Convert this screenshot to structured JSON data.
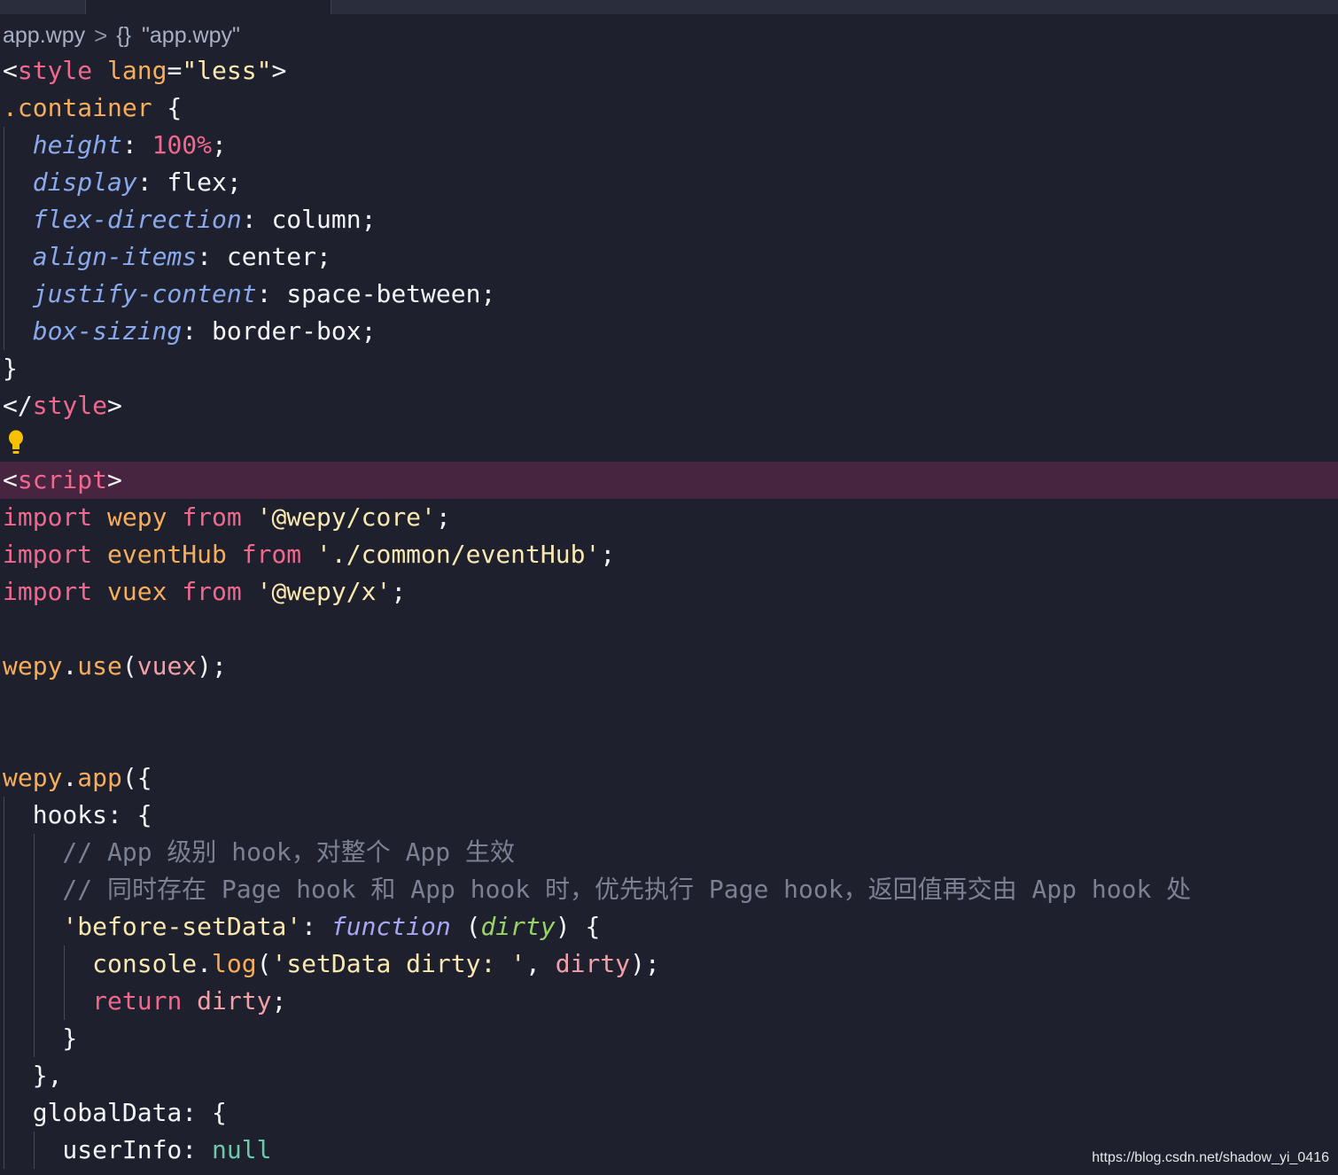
{
  "breadcrumb": {
    "file": "app.wpy",
    "separator": ">",
    "braces": "{}",
    "symbol": "\"app.wpy\""
  },
  "code": {
    "l1": [
      {
        "t": "<",
        "c": "punc"
      },
      {
        "t": "style",
        "c": "tag"
      },
      {
        "t": " ",
        "c": "punc"
      },
      {
        "t": "lang",
        "c": "attr"
      },
      {
        "t": "=",
        "c": "punc"
      },
      {
        "t": "\"less\"",
        "c": "str"
      },
      {
        "t": ">",
        "c": "punc"
      }
    ],
    "l2": [
      {
        "t": ".container",
        "c": "id"
      },
      {
        "t": " {",
        "c": "punc"
      }
    ],
    "l3": [
      {
        "t": "  ",
        "c": "punc"
      },
      {
        "t": "height",
        "c": "prop"
      },
      {
        "t": ": ",
        "c": "punc"
      },
      {
        "t": "100%",
        "c": "num"
      },
      {
        "t": ";",
        "c": "punc"
      }
    ],
    "l4": [
      {
        "t": "  ",
        "c": "punc"
      },
      {
        "t": "display",
        "c": "prop"
      },
      {
        "t": ": ",
        "c": "punc"
      },
      {
        "t": "flex",
        "c": "val"
      },
      {
        "t": ";",
        "c": "punc"
      }
    ],
    "l5": [
      {
        "t": "  ",
        "c": "punc"
      },
      {
        "t": "flex-direction",
        "c": "prop"
      },
      {
        "t": ": ",
        "c": "punc"
      },
      {
        "t": "column",
        "c": "val"
      },
      {
        "t": ";",
        "c": "punc"
      }
    ],
    "l6": [
      {
        "t": "  ",
        "c": "punc"
      },
      {
        "t": "align-items",
        "c": "prop"
      },
      {
        "t": ": ",
        "c": "punc"
      },
      {
        "t": "center",
        "c": "val"
      },
      {
        "t": ";",
        "c": "punc"
      }
    ],
    "l7": [
      {
        "t": "  ",
        "c": "punc"
      },
      {
        "t": "justify-content",
        "c": "prop"
      },
      {
        "t": ": ",
        "c": "punc"
      },
      {
        "t": "space-between",
        "c": "val"
      },
      {
        "t": ";",
        "c": "punc"
      }
    ],
    "l8": [
      {
        "t": "  ",
        "c": "punc"
      },
      {
        "t": "box-sizing",
        "c": "prop"
      },
      {
        "t": ": ",
        "c": "punc"
      },
      {
        "t": "border-box",
        "c": "val"
      },
      {
        "t": ";",
        "c": "punc"
      }
    ],
    "l9": [
      {
        "t": "}",
        "c": "punc"
      }
    ],
    "l10": [
      {
        "t": "</",
        "c": "punc"
      },
      {
        "t": "style",
        "c": "tag"
      },
      {
        "t": ">",
        "c": "punc"
      }
    ],
    "l11": [],
    "l12": [
      {
        "t": "<",
        "c": "punc"
      },
      {
        "t": "script",
        "c": "tag"
      },
      {
        "t": ">",
        "c": "punc"
      }
    ],
    "l13": [
      {
        "t": "import",
        "c": "kw"
      },
      {
        "t": " ",
        "c": "punc"
      },
      {
        "t": "wepy",
        "c": "id"
      },
      {
        "t": " ",
        "c": "punc"
      },
      {
        "t": "from",
        "c": "kw"
      },
      {
        "t": " ",
        "c": "punc"
      },
      {
        "t": "'@wepy/core'",
        "c": "str"
      },
      {
        "t": ";",
        "c": "punc"
      }
    ],
    "l14": [
      {
        "t": "import",
        "c": "kw"
      },
      {
        "t": " ",
        "c": "punc"
      },
      {
        "t": "eventHub",
        "c": "id"
      },
      {
        "t": " ",
        "c": "punc"
      },
      {
        "t": "from",
        "c": "kw"
      },
      {
        "t": " ",
        "c": "punc"
      },
      {
        "t": "'./common/eventHub'",
        "c": "str"
      },
      {
        "t": ";",
        "c": "punc"
      }
    ],
    "l15": [
      {
        "t": "import",
        "c": "kw"
      },
      {
        "t": " ",
        "c": "punc"
      },
      {
        "t": "vuex",
        "c": "id"
      },
      {
        "t": " ",
        "c": "punc"
      },
      {
        "t": "from",
        "c": "kw"
      },
      {
        "t": " ",
        "c": "punc"
      },
      {
        "t": "'@wepy/x'",
        "c": "str"
      },
      {
        "t": ";",
        "c": "punc"
      }
    ],
    "l16": [],
    "l17": [
      {
        "t": "wepy",
        "c": "id"
      },
      {
        "t": ".",
        "c": "punc"
      },
      {
        "t": "use",
        "c": "fn"
      },
      {
        "t": "(",
        "c": "punc"
      },
      {
        "t": "vuex",
        "c": "var"
      },
      {
        "t": ");",
        "c": "punc"
      }
    ],
    "l18": [],
    "l19": [],
    "l20": [
      {
        "t": "wepy",
        "c": "id"
      },
      {
        "t": ".",
        "c": "punc"
      },
      {
        "t": "app",
        "c": "fn"
      },
      {
        "t": "({",
        "c": "punc"
      }
    ],
    "l21": [
      {
        "t": "  hooks: {",
        "c": "punc"
      }
    ],
    "l22": [
      {
        "t": "    // App 级别 hook，对整个 App 生效",
        "c": "cmt"
      }
    ],
    "l23": [
      {
        "t": "    // 同时存在 Page hook 和 App hook 时，优先执行 Page hook，返回值再交由 App hook 处",
        "c": "cmt"
      }
    ],
    "l24": [
      {
        "t": "    ",
        "c": "punc"
      },
      {
        "t": "'before-setData'",
        "c": "str"
      },
      {
        "t": ": ",
        "c": "punc"
      },
      {
        "t": "function",
        "c": "fnkw"
      },
      {
        "t": " (",
        "c": "punc"
      },
      {
        "t": "dirty",
        "c": "param"
      },
      {
        "t": ") {",
        "c": "punc"
      }
    ],
    "l25": [
      {
        "t": "      ",
        "c": "punc"
      },
      {
        "t": "console",
        "c": "str"
      },
      {
        "t": ".",
        "c": "punc"
      },
      {
        "t": "log",
        "c": "fn"
      },
      {
        "t": "(",
        "c": "punc"
      },
      {
        "t": "'setData dirty: '",
        "c": "str"
      },
      {
        "t": ", ",
        "c": "punc"
      },
      {
        "t": "dirty",
        "c": "var"
      },
      {
        "t": ");",
        "c": "punc"
      }
    ],
    "l26": [
      {
        "t": "      ",
        "c": "punc"
      },
      {
        "t": "return",
        "c": "kw"
      },
      {
        "t": " ",
        "c": "punc"
      },
      {
        "t": "dirty",
        "c": "var"
      },
      {
        "t": ";",
        "c": "punc"
      }
    ],
    "l27": [
      {
        "t": "    }",
        "c": "punc"
      }
    ],
    "l28": [
      {
        "t": "  },",
        "c": "punc"
      }
    ],
    "l29": [
      {
        "t": "  globalData: {",
        "c": "punc"
      }
    ],
    "l30": [
      {
        "t": "    userInfo: ",
        "c": "punc"
      },
      {
        "t": "null",
        "c": "null"
      }
    ]
  },
  "watermark": "https://blog.csdn.net/shadow_yi_0416",
  "colors": {
    "background": "#1e212d",
    "highlight_line": "#472440",
    "tag": "#f2678e",
    "keyword": "#f2678e",
    "identifier": "#f7ad5a",
    "string": "#f9e8b1",
    "property": "#8aa9ec",
    "comment": "#7b8193",
    "null": "#6cc9a9",
    "param": "#9ad268",
    "function_keyword": "#a7a6f2",
    "lightbulb": "#f6c100"
  },
  "icons": {
    "lightbulb": "lightbulb-icon"
  }
}
